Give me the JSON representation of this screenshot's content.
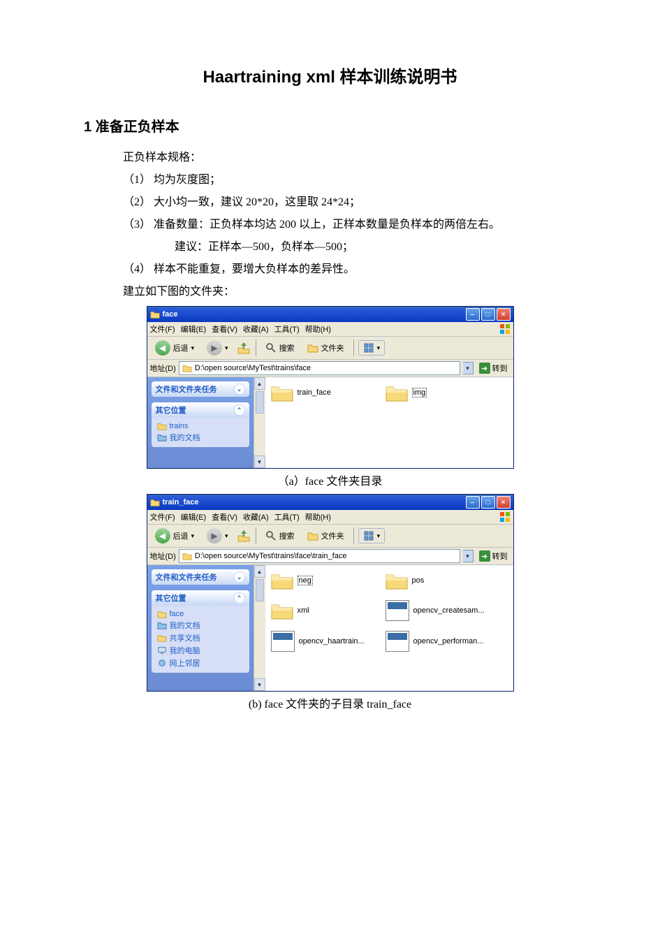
{
  "doc": {
    "title": "Haartraining  xml 样本训练说明书",
    "h2": "1 准备正负样本",
    "p_spec": "正负样本规格：",
    "li1": "（1） 均为灰度图；",
    "li2": "（2） 大小均一致，建议 20*20，这里取 24*24；",
    "li3": "（3） 准备数量：正负样本均达 200 以上，正样本数量是负样本的两倍左右。",
    "li3b": "建议：正样本—500，负样本—500；",
    "li4": "（4） 样本不能重复，要增大负样本的差异性。",
    "p_build": "建立如下图的文件夹：",
    "caption_a": "（a）face 文件夹目录",
    "caption_b": "(b)  face 文件夹的子目录 train_face"
  },
  "win1": {
    "title": "face",
    "menu": {
      "file": "文件(F)",
      "edit": "编辑(E)",
      "view": "查看(V)",
      "fav": "收藏(A)",
      "tools": "工具(T)",
      "help": "帮助(H)"
    },
    "tb": {
      "back": "后退",
      "search": "搜索",
      "folders": "文件夹"
    },
    "addr_label": "地址(D)",
    "addr_path": "D:\\open source\\MyTest\\trains\\face",
    "go": "转到",
    "side_tasks": "文件和文件夹任务",
    "side_other": "其它位置",
    "side_links": {
      "l1": "trains",
      "l2": "我的文档"
    },
    "items": {
      "f1": "train_face",
      "f2": "img"
    }
  },
  "win2": {
    "title": "train_face",
    "menu": {
      "file": "文件(F)",
      "edit": "编辑(E)",
      "view": "查看(V)",
      "fav": "收藏(A)",
      "tools": "工具(T)",
      "help": "帮助(H)"
    },
    "tb": {
      "back": "后退",
      "search": "搜索",
      "folders": "文件夹"
    },
    "addr_label": "地址(D)",
    "addr_path": "D:\\open source\\MyTest\\trains\\face\\train_face",
    "go": "转到",
    "side_tasks": "文件和文件夹任务",
    "side_other": "其它位置",
    "side_links": {
      "l1": "face",
      "l2": "我的文档",
      "l3": "共享文档",
      "l4": "我的电脑",
      "l5": "网上邻居"
    },
    "items": {
      "f1": "neg",
      "f2": "pos",
      "f3": "xml",
      "e1": "opencv_createsam...",
      "e2": "opencv_haartrain...",
      "e3": "opencv_performan..."
    }
  }
}
